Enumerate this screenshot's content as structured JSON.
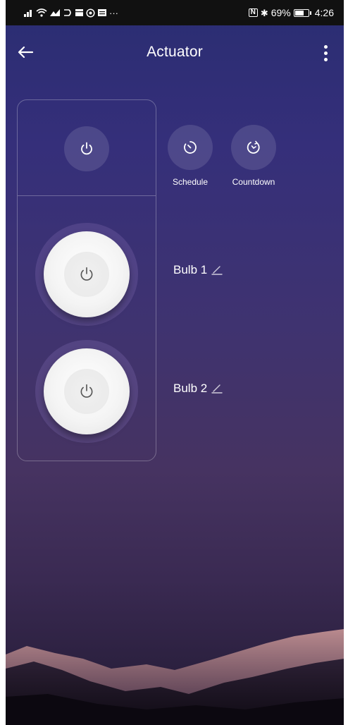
{
  "status_bar": {
    "left_icons": [
      "signal-icon",
      "wifi-icon",
      "mail-icon",
      "cast-icon",
      "calendar-icon",
      "whatsapp-icon",
      "inbox-icon"
    ],
    "more_text": "···",
    "nfc": "N",
    "bluetooth": "✱",
    "battery_percent": "69%",
    "battery_level": 0.69,
    "time": "4:26"
  },
  "header": {
    "title": "Actuator"
  },
  "actions": {
    "schedule_label": "Schedule",
    "countdown_label": "Countdown"
  },
  "bulbs": [
    {
      "label": "Bulb 1"
    },
    {
      "label": "Bulb 2"
    }
  ],
  "colors": {
    "accent": "#ffffff",
    "background_top": "#2a2d72",
    "background_bottom": "#221a33"
  }
}
